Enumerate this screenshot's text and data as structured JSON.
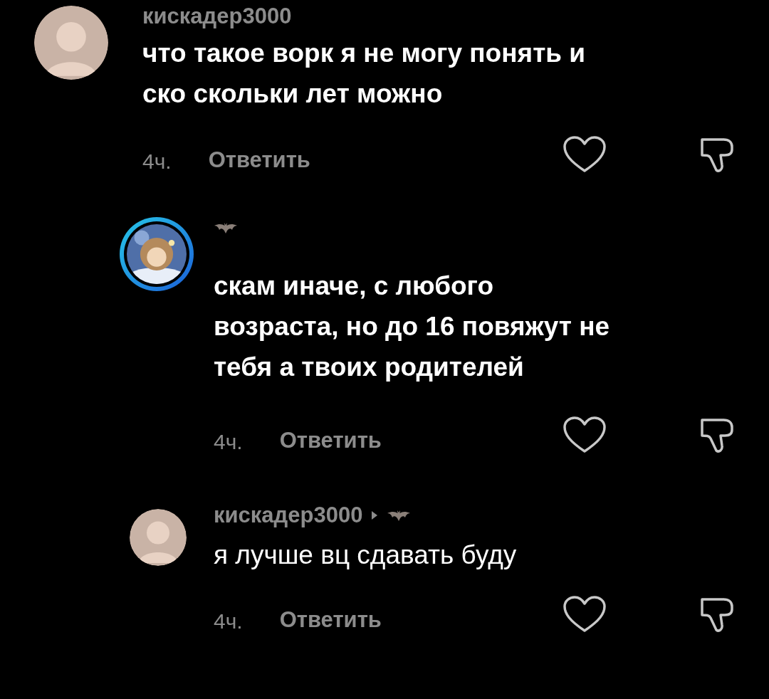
{
  "comments": [
    {
      "kind": "top",
      "username": "кискадер3000",
      "lines": [
        "что такое ворк я не могу понять и",
        "ско скольки лет можно"
      ],
      "time": "4ч.",
      "reply_label": "Ответить"
    },
    {
      "kind": "ring",
      "lines": [
        "скам иначе, с любого",
        "возраста, но до 16 повяжут не",
        "тебя а твоих родителей"
      ],
      "time": "4ч.",
      "reply_label": "Ответить"
    },
    {
      "kind": "reply_to",
      "username": "кискадер3000",
      "lines": [
        "я лучше вц сдавать буду"
      ],
      "time": "4ч.",
      "reply_label": "Ответить"
    }
  ]
}
